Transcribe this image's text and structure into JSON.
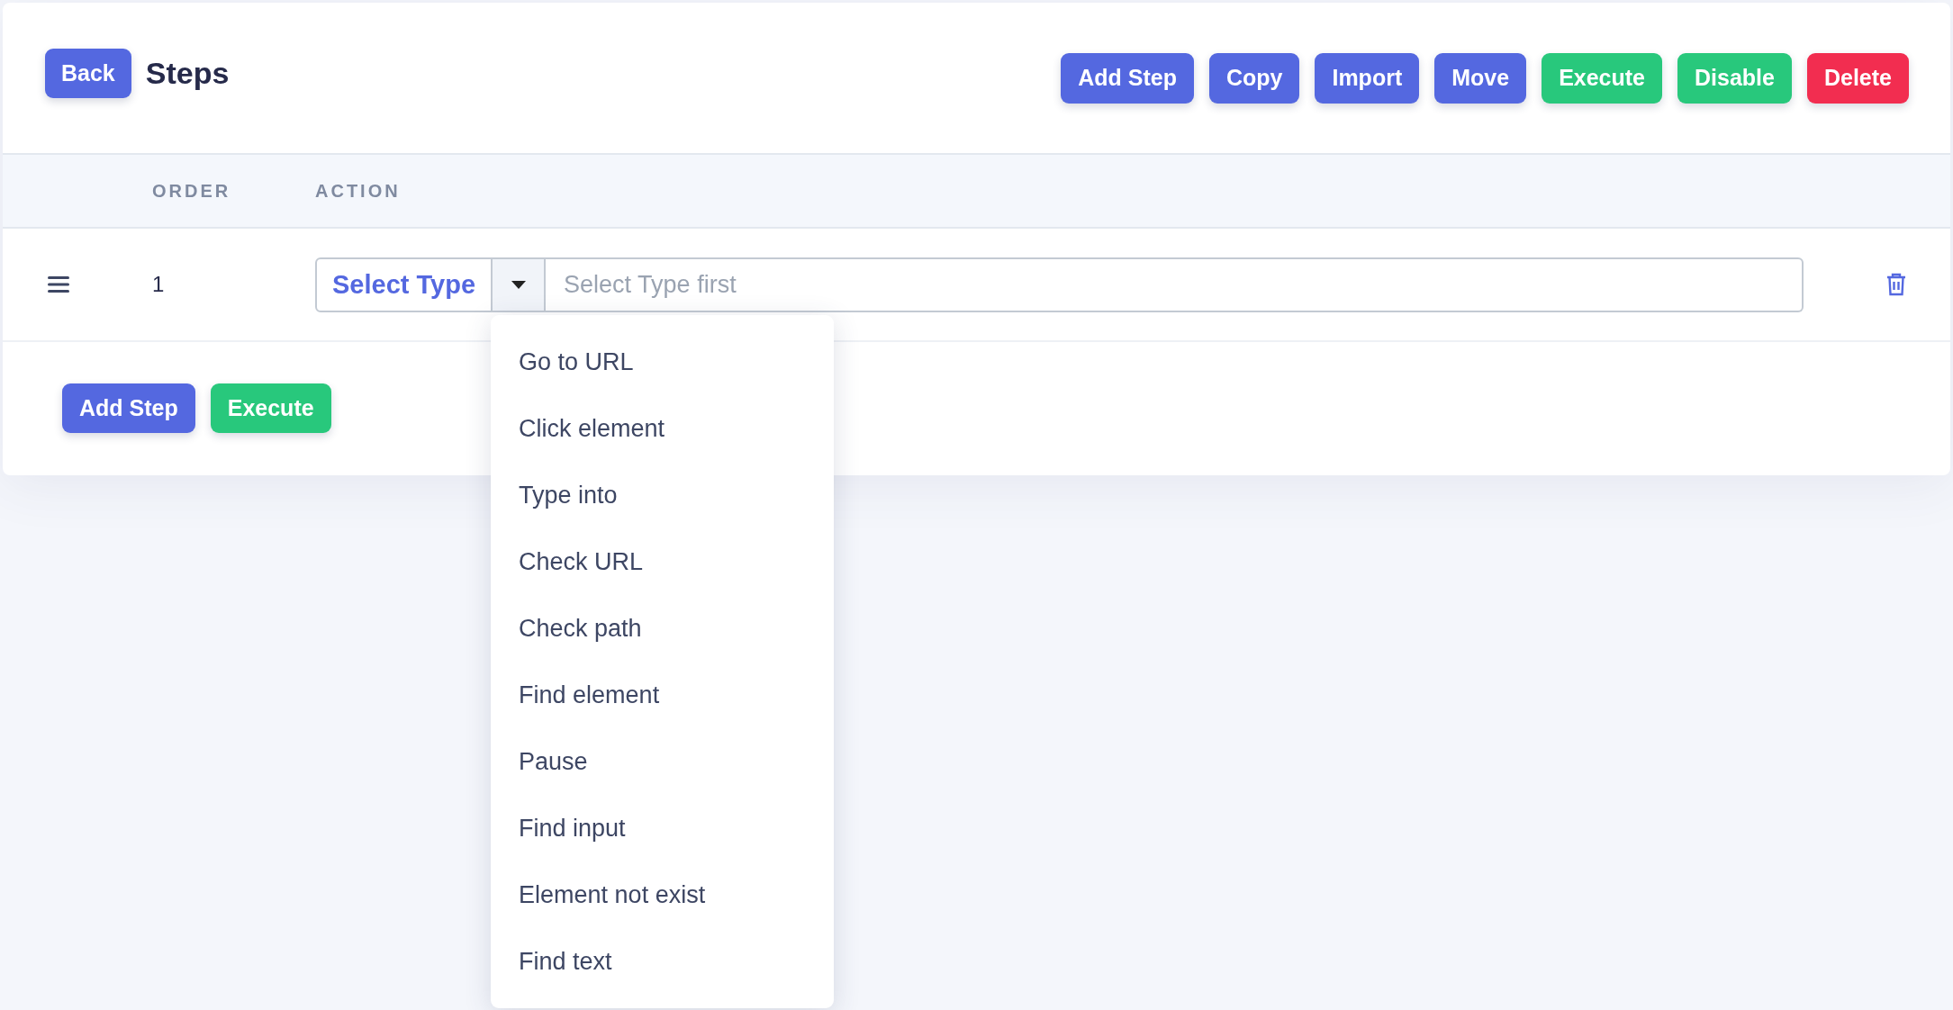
{
  "header": {
    "back_button": "Back",
    "title": "Steps",
    "buttons": [
      {
        "label": "Add Step",
        "kind": "primary"
      },
      {
        "label": "Copy",
        "kind": "primary"
      },
      {
        "label": "Import",
        "kind": "primary"
      },
      {
        "label": "Move",
        "kind": "primary"
      },
      {
        "label": "Execute",
        "kind": "success"
      },
      {
        "label": "Disable",
        "kind": "success"
      },
      {
        "label": "Delete",
        "kind": "danger"
      }
    ]
  },
  "table": {
    "columns": [
      "ORDER",
      "ACTION"
    ],
    "rows": [
      {
        "order": "1",
        "type_select": "Select Type",
        "value_placeholder": "Select Type first"
      }
    ]
  },
  "footer_buttons": [
    {
      "label": "Add Step",
      "kind": "primary"
    },
    {
      "label": "Execute",
      "kind": "success"
    }
  ],
  "type_dropdown": {
    "expanded": true,
    "items": [
      "Go to URL",
      "Click element",
      "Type into",
      "Check URL",
      "Check path",
      "Find element",
      "Pause",
      "Find input",
      "Element not exist",
      "Find text"
    ]
  }
}
